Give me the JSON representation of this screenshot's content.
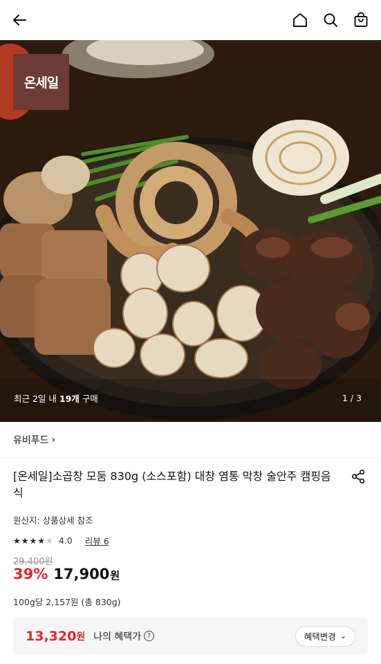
{
  "header": {
    "back_icon": "arrow-left-icon",
    "home_icon": "home-icon",
    "search_icon": "search-icon",
    "cart_icon": "shopping-bag-icon"
  },
  "hero": {
    "brand_badge": "온세일",
    "recent_prefix": "최근 2일 내 ",
    "recent_count": "19개",
    "recent_suffix": " 구매",
    "pager": "1 / 3"
  },
  "seller": {
    "name": "유비푸드",
    "chevron": "›"
  },
  "product": {
    "title": "[온세일]소곱창 모둠 830g (소스포함) 대창 염통 막창 술안주 캠핑음식",
    "origin": "원산지: 상품상세 참조",
    "rating_value": "4.0",
    "rating_stars": 4,
    "review_label": "리뷰 6",
    "original_price": "29,400원",
    "discount_rate": "39%",
    "price": "17,900",
    "price_unit": "원",
    "unit_price": "100g당 2,157원 (총 830g)"
  },
  "benefit": {
    "price": "13,320",
    "price_unit": "원",
    "label": "나의 혜택가",
    "help": "?",
    "change_label": "혜택변경"
  },
  "colors": {
    "accent_red": "#e0282e",
    "brand_badge": "#6b3b34"
  }
}
